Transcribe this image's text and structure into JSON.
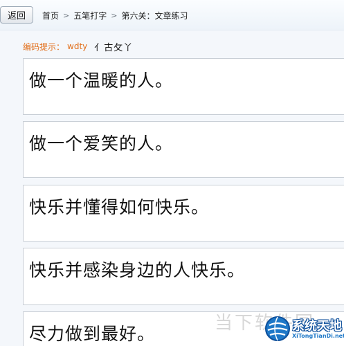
{
  "toolbar": {
    "back_label": "返回",
    "breadcrumb": [
      "首页",
      "五笔打字",
      "第六关：文章练习"
    ],
    "separator": ">"
  },
  "hint": {
    "label": "编码提示：",
    "code": "wdty",
    "roots": "亻古攵丫"
  },
  "cards": [
    "做一个温暖的人。",
    "做一个爱笑的人。",
    "快乐并懂得如何快乐。",
    "快乐并感染身边的人快乐。",
    "尽力做到最好。"
  ],
  "watermark": {
    "shadow_text": "当下软件园",
    "title": "系统天地",
    "url": "XiTongTianDi.net"
  },
  "colors": {
    "hint": "#e2701d",
    "card_border": "#c9cfd6",
    "watermark_blue": "#1e78c8"
  }
}
